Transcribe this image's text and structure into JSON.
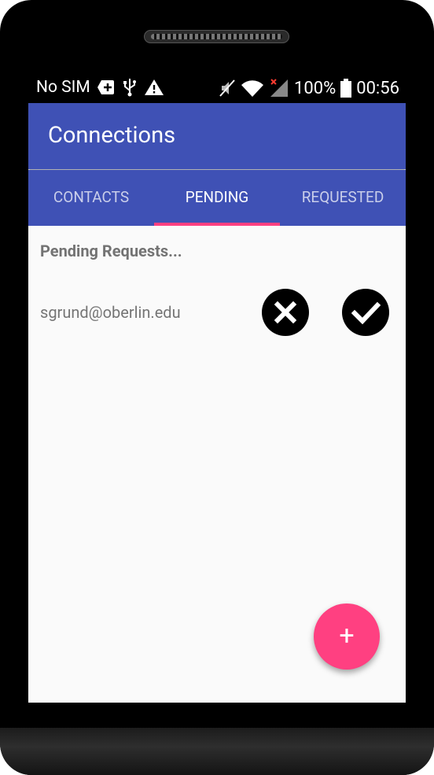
{
  "status_bar": {
    "carrier": "No SIM",
    "battery": "100%",
    "time": "00:56"
  },
  "app": {
    "title": "Connections"
  },
  "tabs": [
    {
      "label": "CONTACTS",
      "active": false
    },
    {
      "label": "PENDING",
      "active": true
    },
    {
      "label": "REQUESTED",
      "active": false
    }
  ],
  "pending": {
    "heading": "Pending Requests...",
    "requests": [
      {
        "email": "sgrund@oberlin.edu"
      }
    ]
  },
  "fab": {
    "icon": "plus-icon",
    "symbol": "+"
  },
  "colors": {
    "primary": "#3f51b5",
    "accent": "#ff4081",
    "background": "#fafafa"
  }
}
